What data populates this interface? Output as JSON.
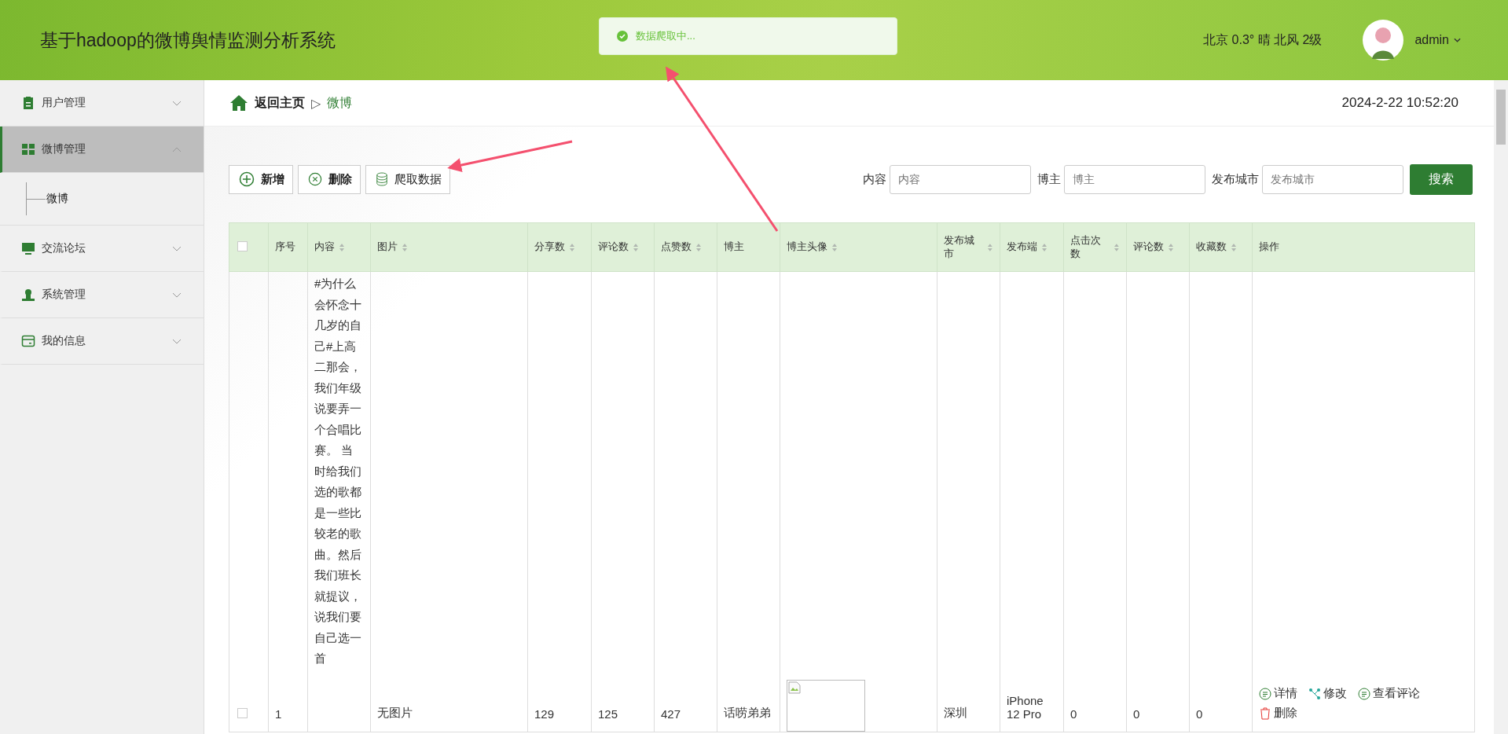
{
  "header": {
    "title": "基于hadoop的微博舆情监测分析系统",
    "weather": "北京 0.3° 晴 北风 2级",
    "user": "admin"
  },
  "toast": {
    "message": "数据爬取中..."
  },
  "sidebar": {
    "items": [
      {
        "kind": "clipboard",
        "label": "用户管理",
        "expanded": false,
        "selected": false
      },
      {
        "kind": "grid",
        "label": "微博管理",
        "expanded": true,
        "selected": true,
        "children": [
          {
            "label": "微博",
            "selected": false
          }
        ]
      },
      {
        "kind": "monitor",
        "label": "交流论坛",
        "expanded": false,
        "selected": false
      },
      {
        "kind": "person",
        "label": "系统管理",
        "expanded": false,
        "selected": false
      },
      {
        "kind": "card",
        "label": "我的信息",
        "expanded": false,
        "selected": false
      }
    ]
  },
  "breadcrumb": {
    "home": "返回主页",
    "separator": "▷",
    "current": "微博"
  },
  "datetime": "2024-2-22 10:52:20",
  "toolbar": {
    "buttons": [
      {
        "kind": "add",
        "label": "新增"
      },
      {
        "kind": "delete",
        "label": "删除"
      },
      {
        "kind": "crawl",
        "label": "爬取数据"
      }
    ],
    "filters": [
      {
        "label": "内容",
        "placeholder": "内容"
      },
      {
        "label": "博主",
        "placeholder": "博主"
      },
      {
        "label": "发布城市",
        "placeholder": "发布城市"
      }
    ],
    "search_button": "搜索"
  },
  "table": {
    "select_all_checked": false,
    "columns": [
      {
        "label": "序号",
        "sortable": false
      },
      {
        "label": "内容",
        "sortable": true
      },
      {
        "label": "图片",
        "sortable": true
      },
      {
        "label": "分享数",
        "sortable": true
      },
      {
        "label": "评论数",
        "sortable": true
      },
      {
        "label": "点赞数",
        "sortable": true
      },
      {
        "label": "博主",
        "sortable": false
      },
      {
        "label": "博主头像",
        "sortable": true
      },
      {
        "label": "发布城市",
        "sortable": true
      },
      {
        "label": "发布端",
        "sortable": true
      },
      {
        "label": "点击次数",
        "sortable": true
      },
      {
        "label": "评论数",
        "sortable": true
      },
      {
        "label": "收藏数",
        "sortable": true
      },
      {
        "label": "操作",
        "sortable": false
      }
    ],
    "rows": [
      {
        "checked": false,
        "index": "1",
        "content": "#为什么会怀念十几岁的自己#上高二那会，我们年级说要弄一个合唱比赛。 当时给我们选的歌都是一些比较老的歌曲。然后我们班长就提议，说我们要自己选一首",
        "picture": "无图片",
        "shares": "129",
        "comments": "125",
        "likes": "427",
        "author": "话唠弟弟",
        "avatar": {
          "kind": "broken-image"
        },
        "city": "深圳",
        "device": "iPhone 12 Pro",
        "clicks": "0",
        "comment_count": "0",
        "favorites": "0",
        "actions": [
          {
            "kind": "detail",
            "label": "详情"
          },
          {
            "kind": "edit",
            "label": "修改"
          },
          {
            "kind": "comments",
            "label": "查看评论"
          },
          {
            "kind": "delete",
            "label": "删除"
          }
        ]
      }
    ]
  }
}
